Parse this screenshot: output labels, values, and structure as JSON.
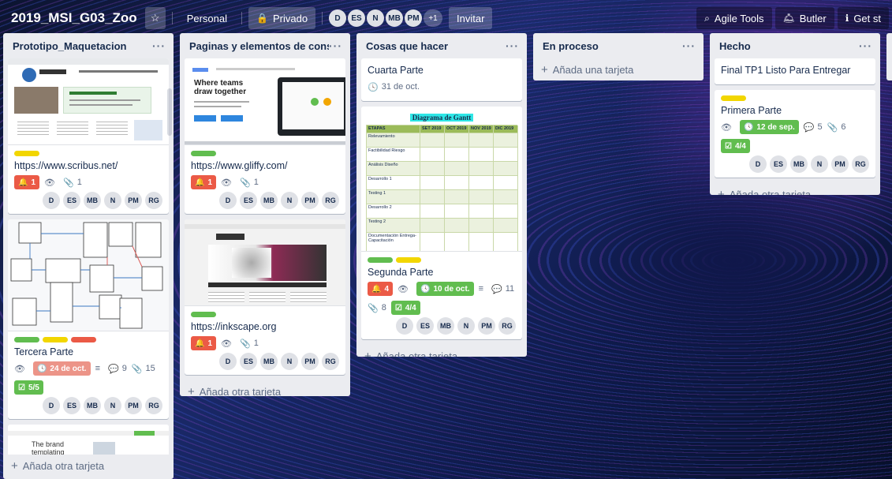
{
  "header": {
    "board_title": "2019_MSI_G03_Zoo",
    "visibility_team": "Personal",
    "visibility": "Privado",
    "members": [
      "D",
      "ES",
      "N",
      "MB",
      "PM"
    ],
    "members_more": "+1",
    "invite": "Invitar",
    "agile_tools": "Agile Tools",
    "butler": "Butler",
    "get_started": "Get st"
  },
  "member_initials": [
    "D",
    "ES",
    "MB",
    "N",
    "PM",
    "RG"
  ],
  "colors": {
    "label_green": "#61bd4f",
    "label_yellow": "#f2d600",
    "label_red": "#eb5a46",
    "list_bg": "#ebecf0"
  },
  "lists": [
    {
      "title": "Prototipo_Maquetacion",
      "add": "Añada otra tarjeta",
      "cards": [
        {
          "cover": "scribus-screenshot",
          "title": "https://www.scribus.net/",
          "notif": "1",
          "attachments": "1"
        },
        {
          "cover": "uml-diagram",
          "title": "Tercera Parte",
          "due": "24 de oct.",
          "comments": "9",
          "attachments": "15",
          "checklist": "5/5"
        },
        {
          "cover": "brand-template-screenshot",
          "cover_text": "The brand templating platform for"
        }
      ]
    },
    {
      "title": "Paginas y elementos de consulta",
      "add": "Añada otra tarjeta",
      "cards": [
        {
          "cover": "gliffy-screenshot",
          "cover_headline": "Where teams draw together",
          "title": "https://www.gliffy.com/",
          "notif": "1",
          "attachments": "1"
        },
        {
          "cover": "inkscape-screenshot",
          "title": "https://inkscape.org",
          "notif": "1",
          "attachments": "1"
        }
      ]
    },
    {
      "title": "Cosas que hacer",
      "add": "Añada otra tarjeta",
      "cards": [
        {
          "title": "Cuarta Parte",
          "due": "31 de oct."
        },
        {
          "cover": "gantt-chart",
          "title": "Segunda Parte",
          "notif": "4",
          "due": "10 de oct.",
          "comments": "11",
          "attachments": "8",
          "checklist": "4/4"
        }
      ]
    },
    {
      "title": "En proceso",
      "add": "Añada una tarjeta"
    },
    {
      "title": "Hecho",
      "add": "Añada otra tarjeta",
      "cards": [
        {
          "title": "Final TP1 Listo Para Entregar"
        },
        {
          "title": "Primera Parte",
          "due": "12 de sep.",
          "comments": "5",
          "attachments": "6",
          "checklist": "4/4"
        }
      ]
    }
  ],
  "gantt": {
    "title": "Diagrama de Gantt",
    "columns": [
      "ETAPAS",
      "SET 2019",
      "OCT 2019",
      "NOV 2019",
      "DIC 2019"
    ],
    "rows": [
      "Relevamiento",
      "Factibilidad Riesgo",
      "Análisis Diseño",
      "Desarrollo 1",
      "Testing 1",
      "Desarrollo 2",
      "Testing 2",
      "Documentación Entrega- Capacitación"
    ]
  }
}
